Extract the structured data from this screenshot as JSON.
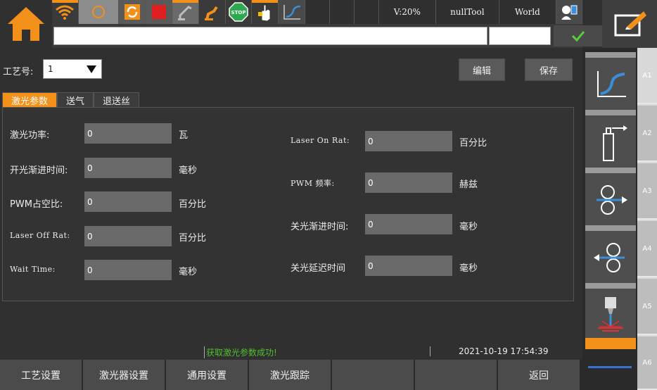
{
  "colors": {
    "accent": "#f39019",
    "success": "#4fbf30",
    "panel": "#303030"
  },
  "topbar": {
    "icons": [
      "wifi-icon",
      "circle-icon",
      "refresh-icon",
      "stop-square-icon",
      "robot-arm-icon",
      "robot-arm-orange-icon",
      "stop-sign-icon",
      "teach-hand-icon",
      "curve-icon"
    ],
    "speed": "V:20%",
    "tool": "nullTool",
    "coord": "World",
    "stop_sign_text": "STOP"
  },
  "form": {
    "process_label": "工艺号:",
    "process_value": "1",
    "edit_label": "编辑",
    "save_label": "保存",
    "tabs": [
      "激光参数",
      "送气",
      "退送丝"
    ],
    "left": [
      {
        "label": "激光功率:",
        "value": "0",
        "unit": "瓦"
      },
      {
        "label": "开光渐进时间:",
        "value": "0",
        "unit": "毫秒"
      },
      {
        "label": "PWM占空比:",
        "value": "0",
        "unit": "百分比"
      },
      {
        "label": "Laser Off Rat:",
        "value": "0",
        "unit": "百分比"
      },
      {
        "label": "Wait Time:",
        "value": "0",
        "unit": "毫秒"
      }
    ],
    "right": [
      {
        "label": "Laser On Rat:",
        "value": "0",
        "unit": "百分比"
      },
      {
        "label": "PWM 频率:",
        "value": "0",
        "unit": "赫兹"
      },
      {
        "label": "关光渐进时间:",
        "value": "0",
        "unit": "毫秒"
      },
      {
        "label": "关光延迟时间",
        "value": "0",
        "unit": "毫秒"
      }
    ]
  },
  "status": {
    "message": "获取激光参数成功!",
    "datetime": "2021-10-19 17:54:39"
  },
  "bottombar": [
    "工艺设置",
    "激光器设置",
    "通用设置",
    "激光跟踪",
    "",
    "",
    "返回"
  ],
  "sidebar": {
    "items": [
      "trajectory-icon",
      "wire-feed-icon",
      "wire-forward-icon",
      "wire-back-icon",
      "laser-icon"
    ],
    "tabs": [
      "A1",
      "A2",
      "A3",
      "A4",
      "A5",
      "A6"
    ]
  }
}
